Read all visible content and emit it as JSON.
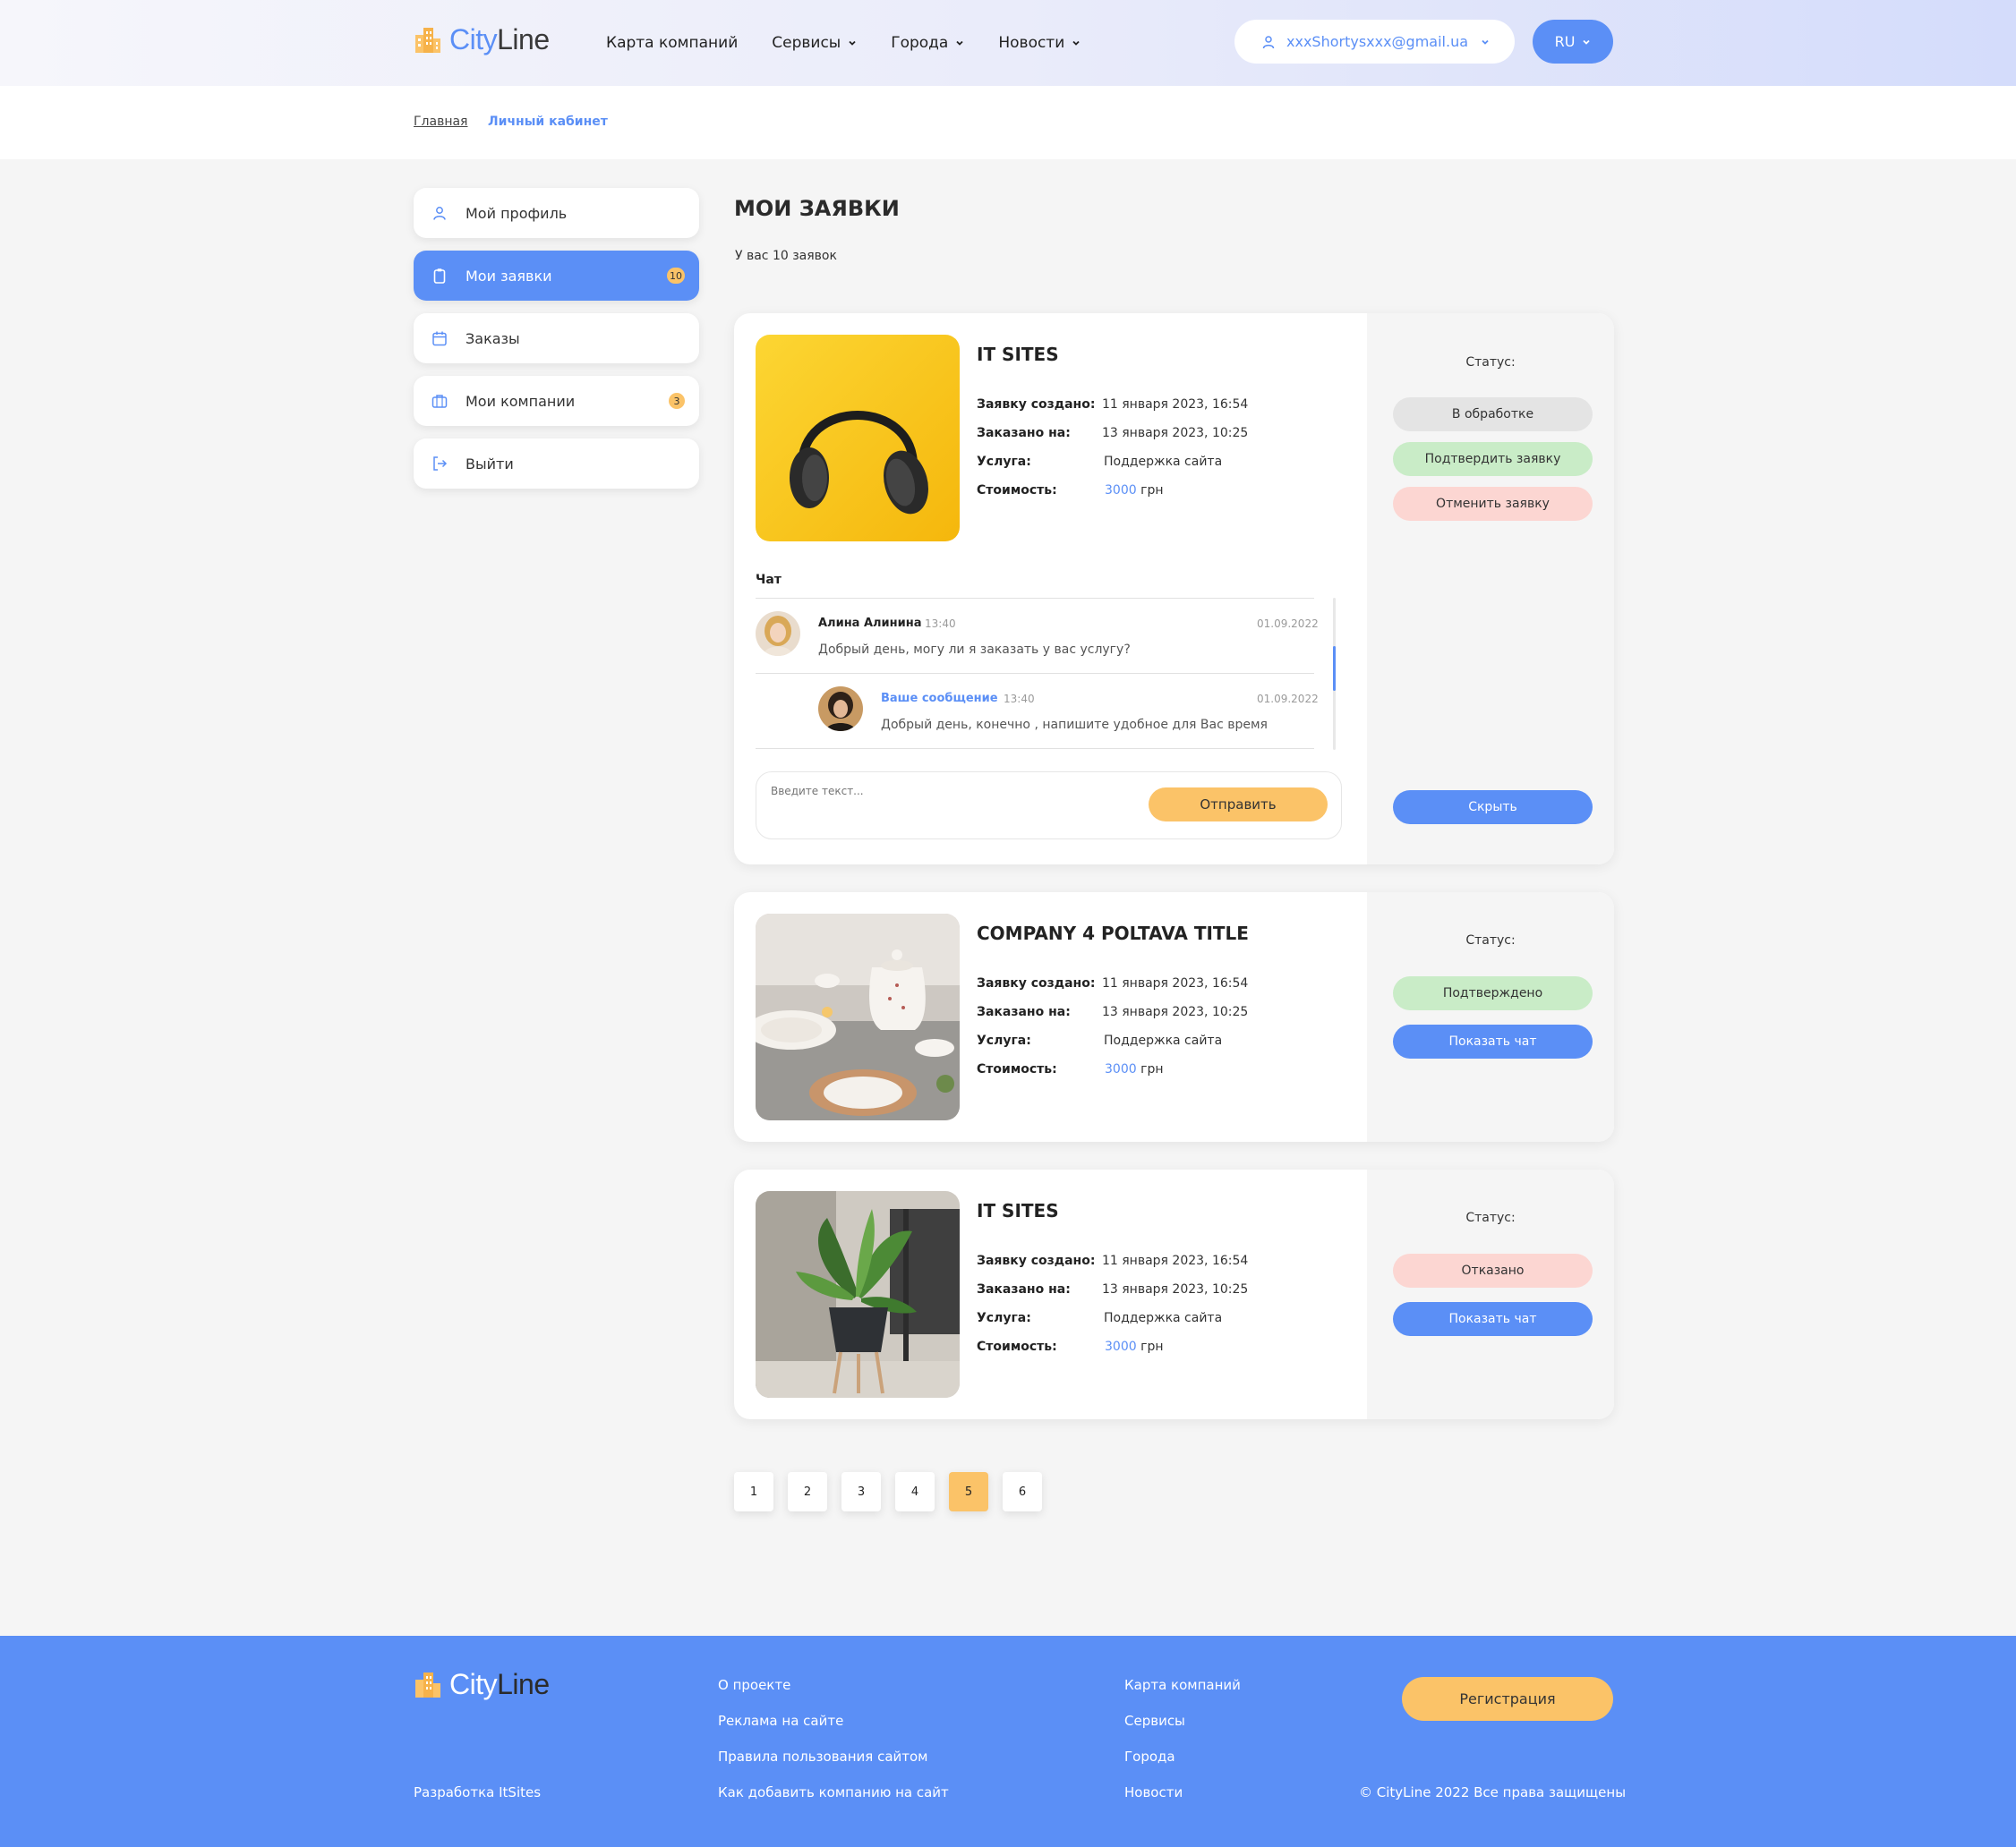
{
  "header": {
    "logo": {
      "part1": "City",
      "part2": "Line"
    },
    "nav": [
      {
        "label": "Карта компаний"
      },
      {
        "label": "Сервисы"
      },
      {
        "label": "Города"
      },
      {
        "label": "Новости"
      }
    ],
    "user_email": "xxxShortysxxx@gmail.ua",
    "lang": "RU"
  },
  "breadcrumb": {
    "home": "Главная",
    "current": "Личный кабинет"
  },
  "sidebar": {
    "items": [
      {
        "label": "Мой профиль",
        "icon": "user-icon"
      },
      {
        "label": "Мои заявки",
        "icon": "clipboard-icon",
        "badge": "10",
        "active": true
      },
      {
        "label": "Заказы",
        "icon": "calendar-icon"
      },
      {
        "label": "Мои компании",
        "icon": "briefcase-icon",
        "badge": "3"
      },
      {
        "label": "Выйти",
        "icon": "logout-icon"
      }
    ]
  },
  "main": {
    "title": "МОИ ЗАЯВКИ",
    "subtitle": "У вас 10 заявок",
    "field_labels": {
      "created": "Заявку создано:",
      "ordered": "Заказано на:",
      "service": "Услуга:",
      "cost": "Стоимость:"
    },
    "status_label": "Статус:",
    "currency": "грн",
    "cards": [
      {
        "title": "IT SITES",
        "created": "11 января 2023, 16:54",
        "ordered": "13 января 2023, 10:25",
        "service": "Поддержка сайта",
        "price": "3000",
        "status_buttons": [
          "В обработке",
          "Подтвердить заявку",
          "Отменить заявку"
        ],
        "action": "Скрыть",
        "chat": {
          "label": "Чат",
          "messages": [
            {
              "author": "Алина Алинина",
              "time": "13:40",
              "date": "01.09.2022",
              "text": "Добрый день, могу ли я заказать у вас услугу?"
            },
            {
              "author": "Ваше сообщение",
              "time": "13:40",
              "date": "01.09.2022",
              "text": "Добрый день, конечно , напишите удобное для Вас время"
            }
          ],
          "placeholder": "Введите текст...",
          "send": "Отправить"
        }
      },
      {
        "title": "COMPANY 4 POLTAVA TITLE",
        "created": "11 января 2023, 16:54",
        "ordered": "13 января 2023, 10:25",
        "service": "Поддержка сайта",
        "price": "3000",
        "status": "Подтверждено",
        "action": "Показать чат"
      },
      {
        "title": "IT SITES",
        "created": "11 января 2023, 16:54",
        "ordered": "13 января 2023, 10:25",
        "service": "Поддержка сайта",
        "price": "3000",
        "status": "Отказано",
        "action": "Показать чат"
      }
    ]
  },
  "pagination": {
    "pages": [
      "1",
      "2",
      "3",
      "4",
      "5",
      "6"
    ],
    "current": "5"
  },
  "footer": {
    "logo": {
      "part1": "City",
      "part2": "Line"
    },
    "dev": "Разработка ItSites",
    "col1": [
      "О проекте",
      "Реклама на сайте",
      "Правила пользования сайтом",
      "Как добавить компанию на сайт"
    ],
    "col2": [
      "Карта компаний",
      "Сервисы",
      "Города",
      "Новости"
    ],
    "register": "Регистрация",
    "copyright": "© CityLine 2022 Все права защищены"
  },
  "colors": {
    "accent": "#5b8ff6",
    "yellow": "#fbc368",
    "green": "#c9ecc7",
    "pink": "#fcd6d2"
  }
}
